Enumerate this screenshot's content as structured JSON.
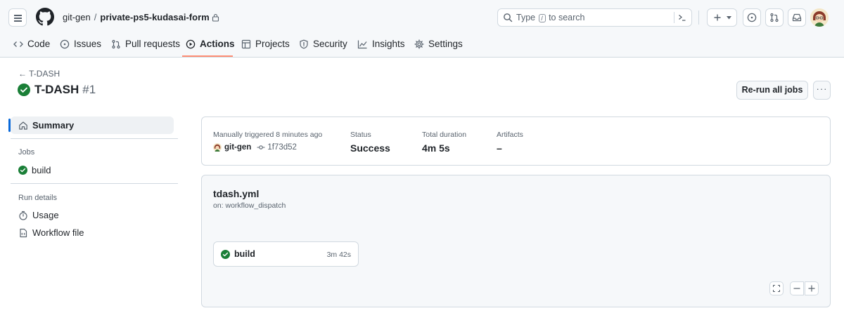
{
  "repo": {
    "owner": "git-gen",
    "separator": "/",
    "name": "private-ps5-kudasai-form"
  },
  "search": {
    "placeholder_before": "Type",
    "key": "/",
    "placeholder_after": "to search"
  },
  "nav_tabs": [
    {
      "label": "Code",
      "icon": "code-icon"
    },
    {
      "label": "Issues",
      "icon": "issue-icon"
    },
    {
      "label": "Pull requests",
      "icon": "pull-request-icon"
    },
    {
      "label": "Actions",
      "icon": "play-icon",
      "active": true
    },
    {
      "label": "Projects",
      "icon": "table-icon"
    },
    {
      "label": "Security",
      "icon": "shield-icon"
    },
    {
      "label": "Insights",
      "icon": "graph-icon"
    },
    {
      "label": "Settings",
      "icon": "gear-icon"
    }
  ],
  "run": {
    "back_label": "T-DASH",
    "title": "T-DASH",
    "number": "#1",
    "status_icon": "check-circle-icon",
    "rerun_label": "Re-run all jobs",
    "more_label": "···"
  },
  "sidebar": {
    "summary_label": "Summary",
    "jobs_heading": "Jobs",
    "jobs": [
      {
        "label": "build",
        "status": "success"
      }
    ],
    "run_details_heading": "Run details",
    "details": [
      {
        "label": "Usage",
        "icon": "stopwatch-icon"
      },
      {
        "label": "Workflow file",
        "icon": "file-code-icon"
      }
    ]
  },
  "summary": {
    "trigger_label": "Manually triggered 8 minutes ago",
    "actor": "git-gen",
    "commit": "1f73d52",
    "status_label": "Status",
    "status_value": "Success",
    "duration_label": "Total duration",
    "duration_value": "4m 5s",
    "artifacts_label": "Artifacts",
    "artifacts_value": "–"
  },
  "workflow": {
    "file": "tdash.yml",
    "trigger": "on: workflow_dispatch",
    "job": {
      "name": "build",
      "duration": "3m 42s"
    }
  },
  "colors": {
    "success": "#1a7f37",
    "accent": "#0969da",
    "tab_underline": "#fd8c73"
  }
}
